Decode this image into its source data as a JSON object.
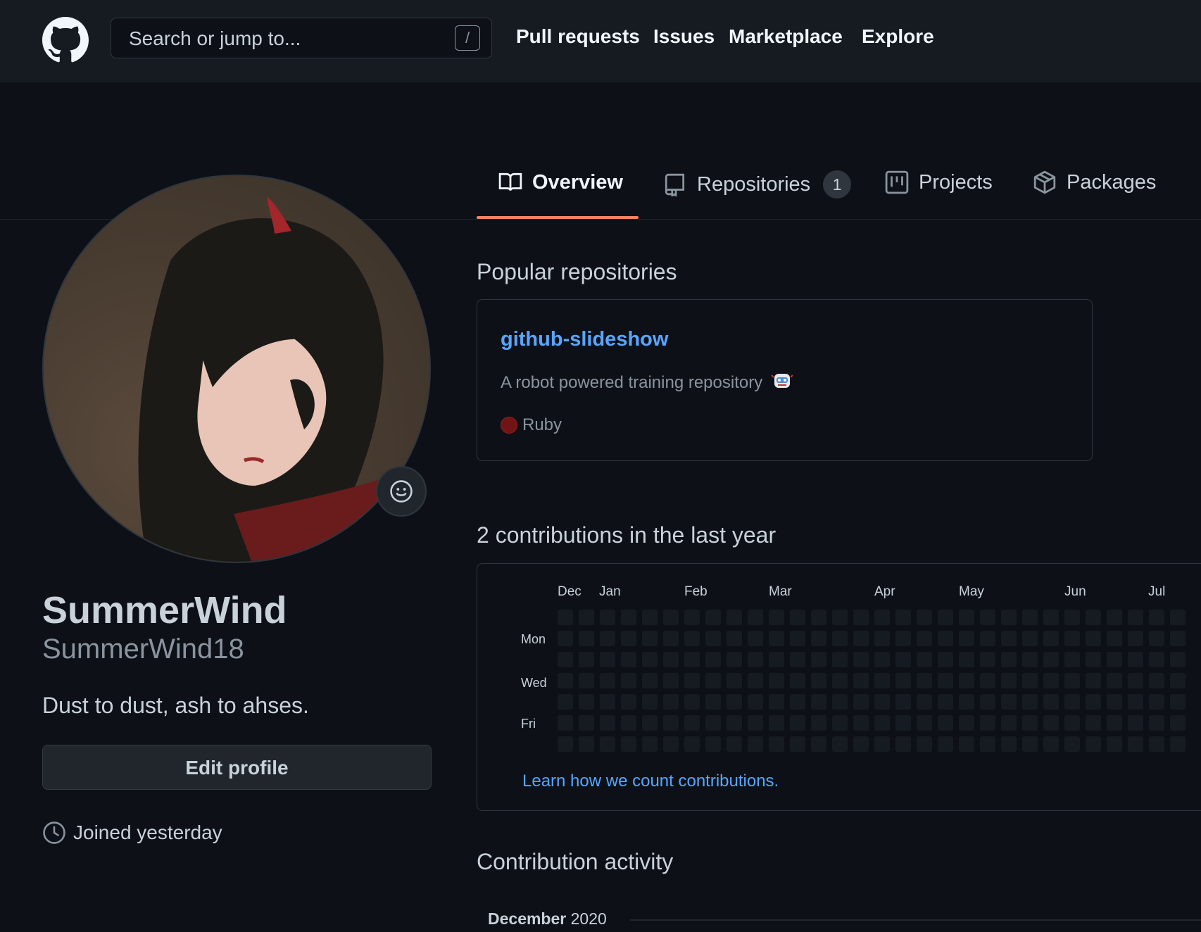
{
  "header": {
    "search_placeholder": "Search or jump to...",
    "search_shortcut": "/",
    "nav": [
      "Pull requests",
      "Issues",
      "Marketplace",
      "Explore"
    ]
  },
  "tabs": {
    "overview": "Overview",
    "repositories": "Repositories",
    "repositories_count": "1",
    "projects": "Projects",
    "packages": "Packages"
  },
  "profile": {
    "fullname": "SummerWind",
    "username": "SummerWind18",
    "bio": "Dust to dust, ash to ahses.",
    "edit_button": "Edit profile",
    "joined": "Joined yesterday"
  },
  "popular": {
    "title": "Popular repositories",
    "repo": {
      "name": "github-slideshow",
      "description": "A robot powered training repository",
      "language": "Ruby",
      "language_color": "#701516"
    }
  },
  "contributions": {
    "title": "2 contributions in the last year",
    "months": [
      "Dec",
      "Jan",
      "Feb",
      "Mar",
      "Apr",
      "May",
      "Jun",
      "Jul"
    ],
    "days": [
      "Mon",
      "Wed",
      "Fri"
    ],
    "learn_link": "Learn how we count contributions.",
    "empty_cell_color": "#161b22"
  },
  "activity": {
    "title": "Contribution activity",
    "month": "December",
    "year": "2020"
  },
  "colors": {
    "background": "#0d1117",
    "header": "#161b22",
    "accent_underline": "#f78166",
    "link": "#58a6ff"
  }
}
